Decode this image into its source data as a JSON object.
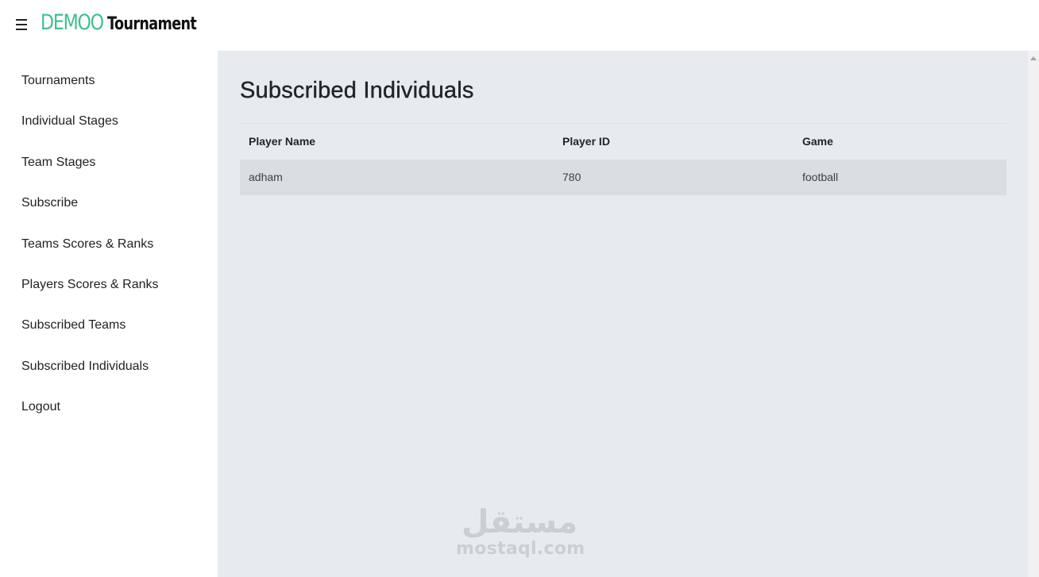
{
  "header": {
    "brand_accent": "DEMOO",
    "brand_rest": "Tournament",
    "menu_icon": "hamburger-icon",
    "accent_color": "#3fbf8f"
  },
  "sidebar": {
    "items": [
      {
        "label": "Tournaments"
      },
      {
        "label": "Individual Stages"
      },
      {
        "label": "Team Stages"
      },
      {
        "label": "Subscribe"
      },
      {
        "label": "Teams Scores & Ranks"
      },
      {
        "label": "Players Scores & Ranks"
      },
      {
        "label": "Subscribed Teams"
      },
      {
        "label": "Subscribed Individuals"
      },
      {
        "label": "Logout"
      }
    ]
  },
  "main": {
    "title": "Subscribed Individuals",
    "table": {
      "columns": [
        "Player Name",
        "Player ID",
        "Game"
      ],
      "rows": [
        [
          "adham",
          "780",
          "football"
        ]
      ]
    },
    "background_color": "#e7ebf0"
  },
  "watermark": {
    "arabic": "مستقل",
    "latin": "mostaql.com"
  }
}
